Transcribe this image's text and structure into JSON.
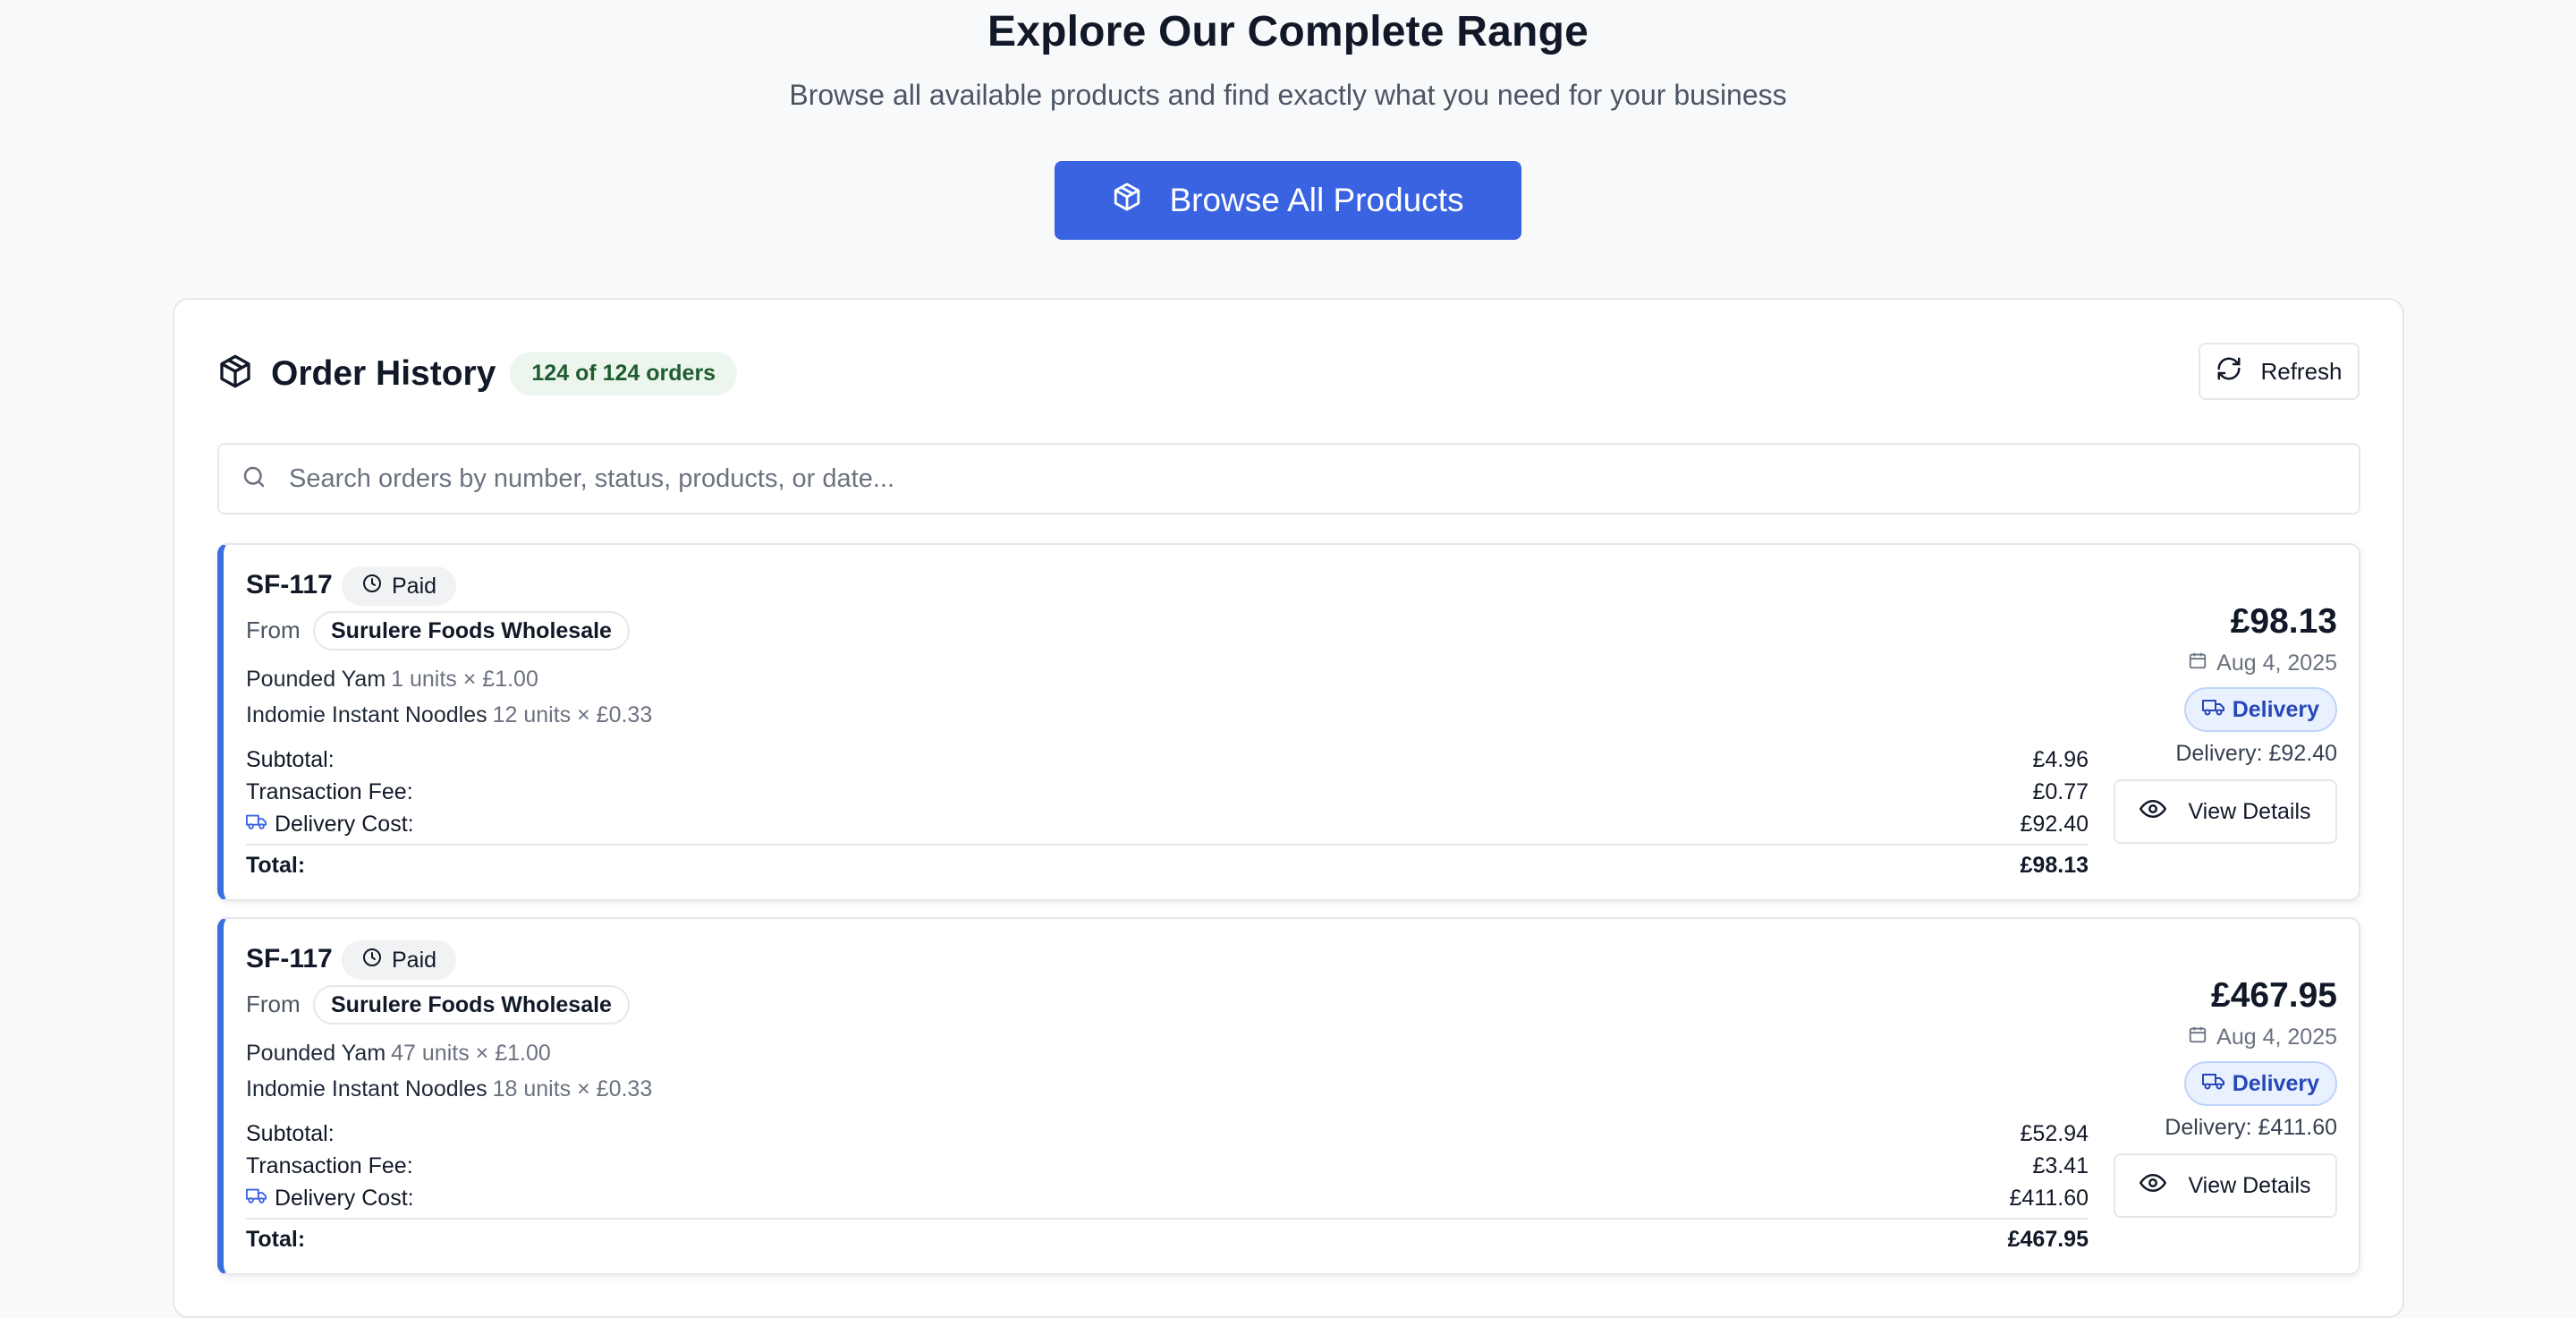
{
  "hero": {
    "title": "Explore Our Complete Range",
    "subtitle": "Browse all available products and find exactly what you need for your business",
    "button_label": "Browse All Products"
  },
  "order_history": {
    "title": "Order History",
    "count_badge": "124 of 124 orders",
    "refresh_label": "Refresh",
    "search_placeholder": "Search orders by number, status, products, or date...",
    "from_label": "From",
    "subtotal_label": "Subtotal:",
    "transaction_fee_label": "Transaction Fee:",
    "delivery_cost_label": "Delivery Cost:",
    "total_label": "Total:",
    "view_details_label": "View Details"
  },
  "orders": [
    {
      "id": "SF-117",
      "status": "Paid",
      "vendor": "Surulere Foods Wholesale",
      "items": [
        {
          "name": "Pounded Yam",
          "qty": "1 units × £1.00"
        },
        {
          "name": "Indomie Instant Noodles",
          "qty": "12 units × £0.33"
        }
      ],
      "subtotal": "£4.96",
      "transaction_fee": "£0.77",
      "delivery_cost": "£92.40",
      "total": "£98.13",
      "big_total": "£98.13",
      "date": "Aug 4, 2025",
      "method": "Delivery",
      "delivery_line": "Delivery: £92.40"
    },
    {
      "id": "SF-117",
      "status": "Paid",
      "vendor": "Surulere Foods Wholesale",
      "items": [
        {
          "name": "Pounded Yam",
          "qty": "47 units × £1.00"
        },
        {
          "name": "Indomie Instant Noodles",
          "qty": "18 units × £0.33"
        }
      ],
      "subtotal": "£52.94",
      "transaction_fee": "£3.41",
      "delivery_cost": "£411.60",
      "total": "£467.95",
      "big_total": "£467.95",
      "date": "Aug 4, 2025",
      "method": "Delivery",
      "delivery_line": "Delivery: £411.60"
    }
  ],
  "colors": {
    "accent": "#3a63e2",
    "card_border_accent": "#3a6fe0",
    "badge_green_bg": "#ecf6ee",
    "badge_green_text": "#1f5c2f",
    "delivery_pill_bg": "#eaf1fe",
    "delivery_pill_text": "#2747b8"
  }
}
